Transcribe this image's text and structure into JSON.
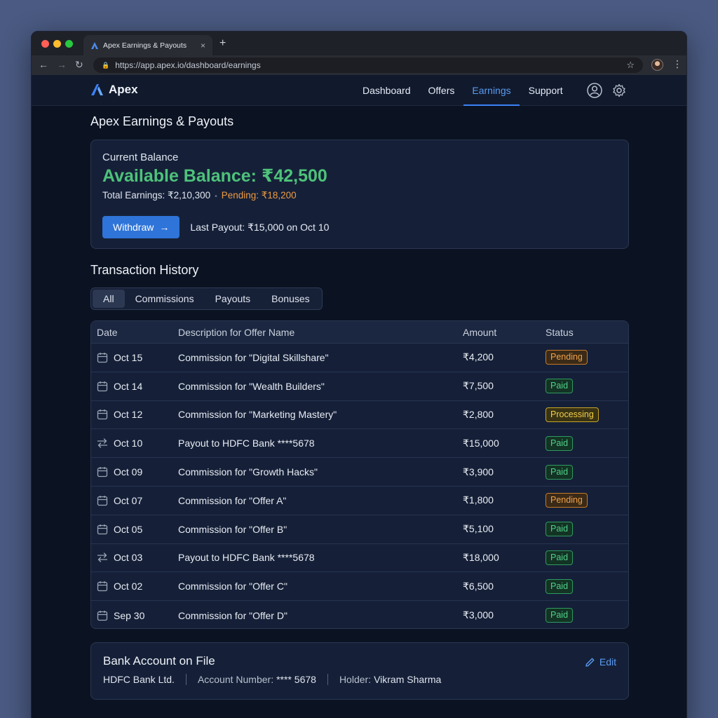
{
  "browser": {
    "tab_title": "Apex Earnings & Payouts",
    "tab_close": "×",
    "new_tab": "+",
    "url": "https://app.apex.io/dashboard/earnings"
  },
  "header": {
    "brand": "Apex",
    "nav": [
      "Dashboard",
      "Offers",
      "Earnings",
      "Support"
    ],
    "active_nav": "Earnings"
  },
  "page": {
    "title": "Apex Earnings & Payouts"
  },
  "balance": {
    "label": "Current Balance",
    "available": "Available Balance: ₹42,500",
    "total": "Total Earnings: ₹2,10,300",
    "pending": "Pending: ₹18,200",
    "withdraw_label": "Withdraw",
    "last_payout": "Last Payout: ₹15,000 on Oct 10"
  },
  "transactions": {
    "title": "Transaction History",
    "filters": [
      "All",
      "Commissions",
      "Payouts",
      "Bonuses"
    ],
    "active_filter": "All",
    "columns": [
      "Date",
      "Description for Offer Name",
      "Amount",
      "Status"
    ],
    "rows": [
      {
        "icon": "calendar-icon",
        "date": "Oct 15",
        "desc": "Commission for \"Digital Skillshare\"",
        "amount": "₹4,200",
        "status": "Pending"
      },
      {
        "icon": "calendar-icon",
        "date": "Oct 14",
        "desc": "Commission for \"Wealth Builders\"",
        "amount": "₹7,500",
        "status": "Paid"
      },
      {
        "icon": "calendar-icon",
        "date": "Oct 12",
        "desc": "Commission for \"Marketing Mastery\"",
        "amount": "₹2,800",
        "status": "Processing"
      },
      {
        "icon": "transfer-icon",
        "date": "Oct 10",
        "desc": "Payout to HDFC Bank ****5678",
        "amount": "₹15,000",
        "status": "Paid"
      },
      {
        "icon": "calendar-icon",
        "date": "Oct 09",
        "desc": "Commission for \"Growth Hacks\"",
        "amount": "₹3,900",
        "status": "Paid"
      },
      {
        "icon": "calendar-icon",
        "date": "Oct 07",
        "desc": "Commission for \"Offer A\"",
        "amount": "₹1,800",
        "status": "Pending"
      },
      {
        "icon": "calendar-icon",
        "date": "Oct 05",
        "desc": "Commission for \"Offer B\"",
        "amount": "₹5,100",
        "status": "Paid"
      },
      {
        "icon": "transfer-icon",
        "date": "Oct 03",
        "desc": "Payout to HDFC Bank ****5678",
        "amount": "₹18,000",
        "status": "Paid"
      },
      {
        "icon": "calendar-icon",
        "date": "Oct 02",
        "desc": "Commission for \"Offer C\"",
        "amount": "₹6,500",
        "status": "Paid"
      },
      {
        "icon": "calendar-icon",
        "date": "Sep 30",
        "desc": "Commission for \"Offer D\"",
        "amount": "₹3,000",
        "status": "Paid"
      }
    ]
  },
  "bank": {
    "title": "Bank Account on File",
    "bank_name": "HDFC Bank Ltd.",
    "account_label": "Account Number:",
    "account_value": "**** 5678",
    "holder_label": "Holder:",
    "holder_value": "Vikram Sharma",
    "edit_label": "Edit"
  },
  "colors": {
    "accent": "#3b82f6",
    "balance_green": "#4ec27a",
    "pending_orange": "#ee9a43",
    "processing_yellow": "#f2cf4a"
  }
}
